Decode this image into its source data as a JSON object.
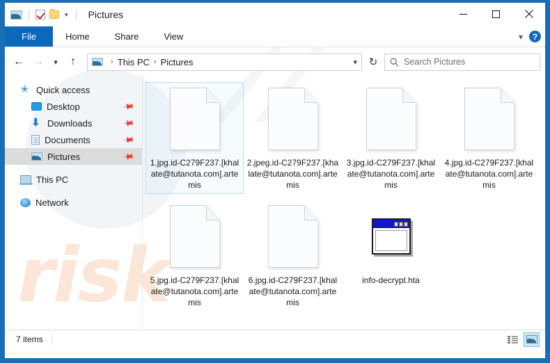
{
  "window": {
    "title": "Pictures",
    "frame_color": "#1a6eb5",
    "quick_access": [
      {
        "name": "pictures-icon",
        "label": "Pictures"
      },
      {
        "name": "properties-icon",
        "label": "Properties"
      },
      {
        "name": "new-folder-icon",
        "label": "New folder"
      },
      {
        "name": "customize-chevron",
        "label": "Customize Quick Access Toolbar"
      }
    ],
    "controls": {
      "minimize": "─",
      "maximize": "□",
      "close": "✕"
    }
  },
  "ribbon": {
    "tabs": [
      {
        "label": "File",
        "active_file": true
      },
      {
        "label": "Home",
        "active_file": false
      },
      {
        "label": "Share",
        "active_file": false
      },
      {
        "label": "View",
        "active_file": false
      }
    ],
    "collapse_chevron": "⌄",
    "help_label": "?"
  },
  "addressbar": {
    "back": "←",
    "forward": "→",
    "history": "⌄",
    "up": "↑",
    "breadcrumbs": [
      "This PC",
      "Pictures"
    ],
    "separator": "›",
    "dropdown": "⌄",
    "refresh": "↻"
  },
  "search": {
    "placeholder": "Search Pictures",
    "icon": "search-icon"
  },
  "sidebar": {
    "items": [
      {
        "label": "Quick access",
        "icon": "star-icon",
        "indent": false,
        "pinned": false,
        "selected": false
      },
      {
        "label": "Desktop",
        "icon": "desktop-icon",
        "indent": true,
        "pinned": true,
        "selected": false
      },
      {
        "label": "Downloads",
        "icon": "downloads-icon",
        "indent": true,
        "pinned": true,
        "selected": false
      },
      {
        "label": "Documents",
        "icon": "documents-icon",
        "indent": true,
        "pinned": true,
        "selected": false
      },
      {
        "label": "Pictures",
        "icon": "pictures-icon",
        "indent": true,
        "pinned": true,
        "selected": true
      },
      {
        "label": "This PC",
        "icon": "this-pc-icon",
        "indent": false,
        "pinned": false,
        "selected": false
      },
      {
        "label": "Network",
        "icon": "network-icon",
        "indent": false,
        "pinned": false,
        "selected": false
      }
    ],
    "pin_glyph": "📌"
  },
  "files": [
    {
      "name": "1.jpg.id-C279F237.[khalate@tutanota.com].artemis",
      "icon": "blank-document-icon",
      "selected": true
    },
    {
      "name": "2.jpeg.id-C279F237.[khalate@tutanota.com].artemis",
      "icon": "blank-document-icon",
      "selected": false
    },
    {
      "name": "3.jpg.id-C279F237.[khalate@tutanota.com].artemis",
      "icon": "blank-document-icon",
      "selected": false
    },
    {
      "name": "4.jpg.id-C279F237.[khalate@tutanota.com].artemis",
      "icon": "blank-document-icon",
      "selected": false
    },
    {
      "name": "5.jpg.id-C279F237.[khalate@tutanota.com].artemis",
      "icon": "blank-document-icon",
      "selected": false
    },
    {
      "name": "6.jpg.id-C279F237.[khalate@tutanota.com].artemis",
      "icon": "blank-document-icon",
      "selected": false
    },
    {
      "name": "info-decrypt.hta",
      "icon": "hta-window-icon",
      "selected": false
    }
  ],
  "statusbar": {
    "item_count": "7 items",
    "views": [
      {
        "name": "details-view-button",
        "active": false
      },
      {
        "name": "large-icons-view-button",
        "active": true
      }
    ]
  },
  "watermark": {
    "text_main": "risk",
    "text_diag": "//"
  }
}
